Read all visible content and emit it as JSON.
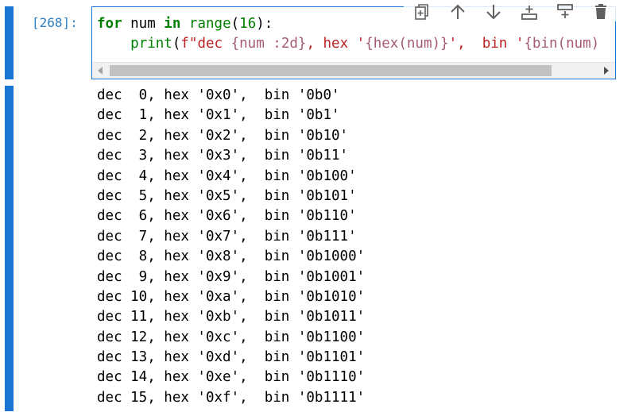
{
  "cell": {
    "prompt": "[268]:",
    "code": {
      "line1": {
        "kw_for": "for",
        "var": " num ",
        "kw_in": "in",
        "sp": " ",
        "fn_range": "range",
        "open": "(",
        "num": "16",
        "close": "):"
      },
      "line2": {
        "indent": "    ",
        "fn_print": "print",
        "open": "(",
        "str1": "f\"dec ",
        "fmt1": "{num :2d}",
        "str2": ", hex '",
        "fmt2": "{hex(num)}",
        "str3": "',  bin '",
        "fmt3": "{bin(num)"
      }
    },
    "toolbar": [
      {
        "name": "duplicate-icon"
      },
      {
        "name": "arrow-up-icon"
      },
      {
        "name": "arrow-down-icon"
      },
      {
        "name": "insert-above-icon"
      },
      {
        "name": "insert-below-icon"
      },
      {
        "name": "trash-icon"
      }
    ],
    "colors": {
      "cell_bar": "#1976d2",
      "prompt": "#307fc1",
      "keyword": "#008000",
      "string": "#ba2121"
    }
  },
  "output": {
    "lines": [
      "dec  0, hex '0x0',  bin '0b0'",
      "dec  1, hex '0x1',  bin '0b1'",
      "dec  2, hex '0x2',  bin '0b10'",
      "dec  3, hex '0x3',  bin '0b11'",
      "dec  4, hex '0x4',  bin '0b100'",
      "dec  5, hex '0x5',  bin '0b101'",
      "dec  6, hex '0x6',  bin '0b110'",
      "dec  7, hex '0x7',  bin '0b111'",
      "dec  8, hex '0x8',  bin '0b1000'",
      "dec  9, hex '0x9',  bin '0b1001'",
      "dec 10, hex '0xa',  bin '0b1010'",
      "dec 11, hex '0xb',  bin '0b1011'",
      "dec 12, hex '0xc',  bin '0b1100'",
      "dec 13, hex '0xd',  bin '0b1101'",
      "dec 14, hex '0xe',  bin '0b1110'",
      "dec 15, hex '0xf',  bin '0b1111'"
    ]
  }
}
